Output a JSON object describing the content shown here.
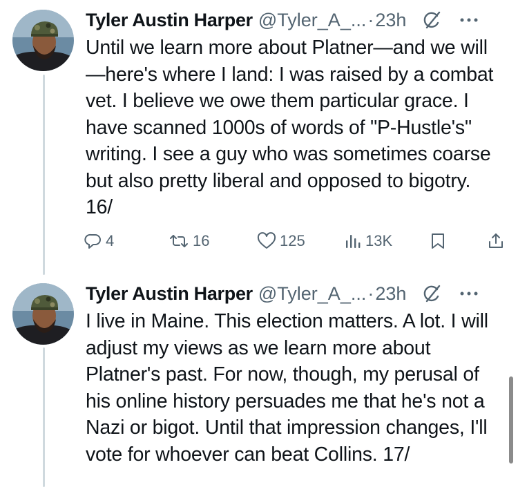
{
  "tweets": [
    {
      "author_name": "Tyler Austin Harper",
      "handle": "@Tyler_A_...",
      "separator": "·",
      "time": "23h",
      "text": "Until we learn more about Platner—and we will—here's where I land: I was raised by a combat vet. I believe we owe them particular grace. I have scanned 1000s of words of \"P-Hustle's\" writing. I see a guy who was sometimes coarse but also pretty liberal and opposed to bigotry. 16/",
      "replies": "4",
      "reposts": "16",
      "likes": "125",
      "views": "13K"
    },
    {
      "author_name": "Tyler Austin Harper",
      "handle": "@Tyler_A_...",
      "separator": "·",
      "time": "23h",
      "text": "I live in Maine. This election matters. A lot. I will adjust my views as we learn more about Platner's past. For now, though, my perusal of his online history persuades me that he's not a Nazi or bigot. Until that impression changes, I'll vote for whoever can beat Collins. 17/"
    }
  ],
  "icons": {
    "reply": "reply-icon",
    "repost": "repost-icon",
    "like": "heart-icon",
    "views": "views-icon",
    "bookmark": "bookmark-icon",
    "share": "share-icon",
    "grok": "grok-icon",
    "more": "more-icon"
  },
  "colors": {
    "text": "#0f1419",
    "secondary": "#536471",
    "thread_line": "#cfd9de",
    "background": "#ffffff"
  }
}
